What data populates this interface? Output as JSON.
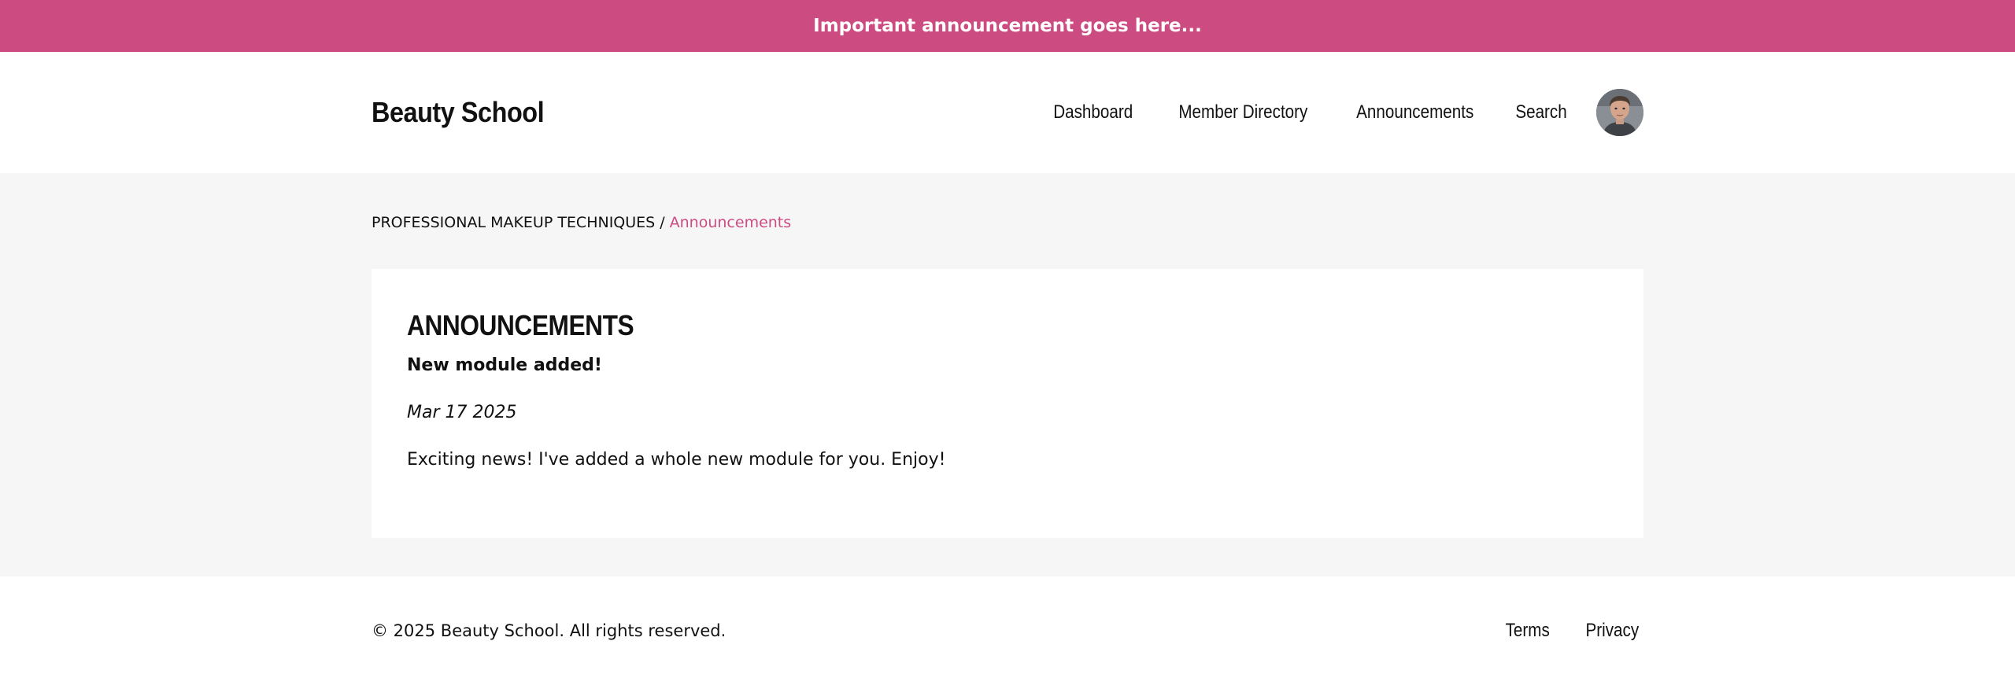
{
  "announcement_bar": {
    "text": "Important announcement goes here..."
  },
  "header": {
    "brand": "Beauty School",
    "nav": [
      {
        "label": "Dashboard"
      },
      {
        "label": "Member Directory"
      },
      {
        "label": "Announcements"
      },
      {
        "label": "Search"
      }
    ],
    "avatar_icon": "user-avatar-photo"
  },
  "breadcrumb": {
    "course": "PROFESSIONAL MAKEUP TECHNIQUES",
    "separator": "/",
    "current": "Announcements"
  },
  "announcements": {
    "heading": "ANNOUNCEMENTS",
    "posts": [
      {
        "title": "New module added!",
        "date": "Mar 17 2025",
        "body": "Exciting news! I've added a whole new module for you. Enjoy!"
      }
    ]
  },
  "footer": {
    "copyright": "© 2025 Beauty School. All rights reserved.",
    "links": [
      {
        "label": "Terms"
      },
      {
        "label": "Privacy"
      }
    ]
  },
  "colors": {
    "accent": "#cc4c82",
    "page_background": "#f6f6f6",
    "text": "#111111"
  }
}
